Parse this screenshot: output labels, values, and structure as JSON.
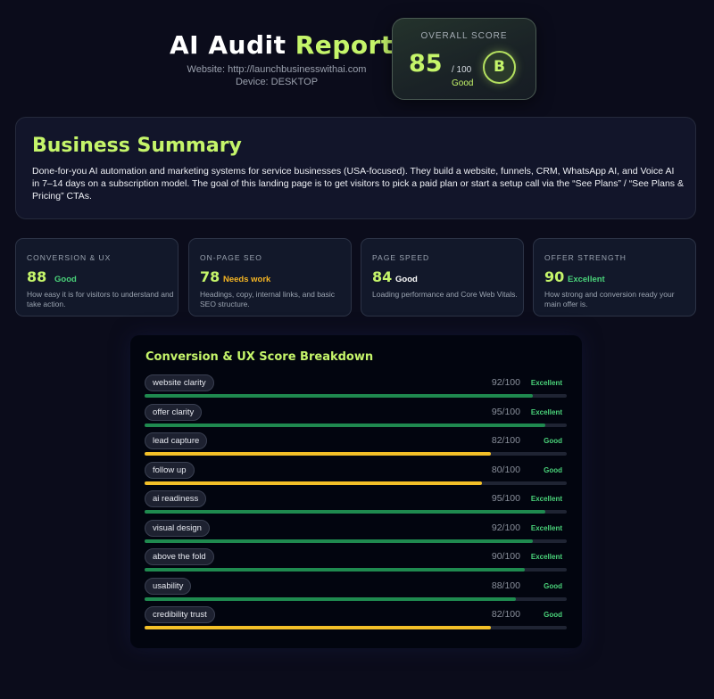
{
  "header": {
    "title_part1": "AI Audit",
    "title_part2": "Report",
    "website": "Website: http://launchbusinesswithai.com",
    "device": "Device: DESKTOP"
  },
  "overall": {
    "label": "OVERALL SCORE",
    "score": "85",
    "out_of": "/ 100",
    "rating": "Good",
    "grade": "B"
  },
  "summary": {
    "heading": "Business Summary",
    "text": "Done-for-you AI automation and marketing systems for service businesses (USA-focused). They build a website, funnels, CRM, WhatsApp AI, and Voice AI in 7–14 days on a subscription model. The goal of this landing page is to get visitors to pick a paid plan or start a setup call via the “See Plans” / “See Plans & Pricing” CTAs."
  },
  "metrics": [
    {
      "label": "CONVERSION & UX",
      "score": "88",
      "grade": "Good",
      "grade_color": "#4ad37a",
      "description": "How easy it is for visitors to understand and take action."
    },
    {
      "label": "ON-PAGE SEO",
      "score": "78",
      "grade": "Needs work",
      "grade_color": "#f5b523",
      "description": "Headings, copy, internal links, and basic SEO structure."
    },
    {
      "label": "PAGE SPEED",
      "score": "84",
      "grade": "Good",
      "grade_color": "#ffffff",
      "description": "Loading performance and Core Web Vitals."
    },
    {
      "label": "OFFER STRENGTH",
      "score": "90",
      "grade": "Excellent",
      "grade_color": "#4ad37a",
      "description": "How strong and conversion ready your main offer is."
    }
  ],
  "breakdown": {
    "heading": "Conversion & UX Score Breakdown",
    "rows": [
      {
        "name": "website clarity",
        "score_text": "92/100",
        "score": 92,
        "grade": "Excellent",
        "bar_color": "#1f8a4f"
      },
      {
        "name": "offer clarity",
        "score_text": "95/100",
        "score": 95,
        "grade": "Excellent",
        "bar_color": "#1f8a4f"
      },
      {
        "name": "lead capture",
        "score_text": "82/100",
        "score": 82,
        "grade": "Good",
        "bar_color": "#f3c028"
      },
      {
        "name": "follow up",
        "score_text": "80/100",
        "score": 80,
        "grade": "Good",
        "bar_color": "#f3c028"
      },
      {
        "name": "ai readiness",
        "score_text": "95/100",
        "score": 95,
        "grade": "Excellent",
        "bar_color": "#1f8a4f"
      },
      {
        "name": "visual design",
        "score_text": "92/100",
        "score": 92,
        "grade": "Excellent",
        "bar_color": "#1f8a4f"
      },
      {
        "name": "above the fold",
        "score_text": "90/100",
        "score": 90,
        "grade": "Excellent",
        "bar_color": "#1f8a4f"
      },
      {
        "name": "usability",
        "score_text": "88/100",
        "score": 88,
        "grade": "Good",
        "bar_color": "#1f8a4f"
      },
      {
        "name": "credibility trust",
        "score_text": "82/100",
        "score": 82,
        "grade": "Good",
        "bar_color": "#f3c028"
      }
    ]
  }
}
